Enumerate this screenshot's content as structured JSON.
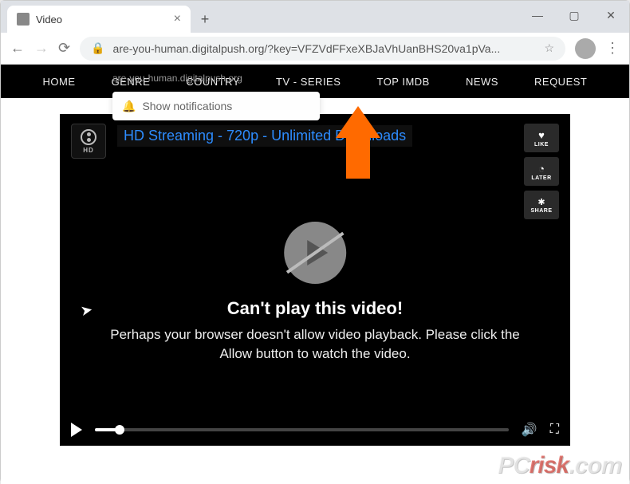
{
  "window": {
    "tab_title": "Video",
    "url_display": "are-you-human.digitalpush.org/?key=VFZVdFFxeXBJaVhUanBHS20va1pVa...",
    "notif_domain": "are-you-human.digitalpush.org",
    "notif_prompt": "Show notifications"
  },
  "site_nav": {
    "items": [
      "HOME",
      "GENRE",
      "COUNTRY",
      "TV - SERIES",
      "TOP IMDB",
      "NEWS",
      "REQUEST"
    ]
  },
  "player": {
    "hd_label": "HD",
    "stream_title": "HD Streaming - 720p - Unlimited Downloads",
    "side": {
      "like": "LIKE",
      "later": "LATER",
      "share": "SHARE"
    },
    "error_title": "Can't play this video!",
    "error_desc": "Perhaps your browser doesn't allow video playback. Please click the Allow button to watch the video."
  },
  "watermark": {
    "left": "PC",
    "mid": "risk",
    "right": ".com"
  }
}
